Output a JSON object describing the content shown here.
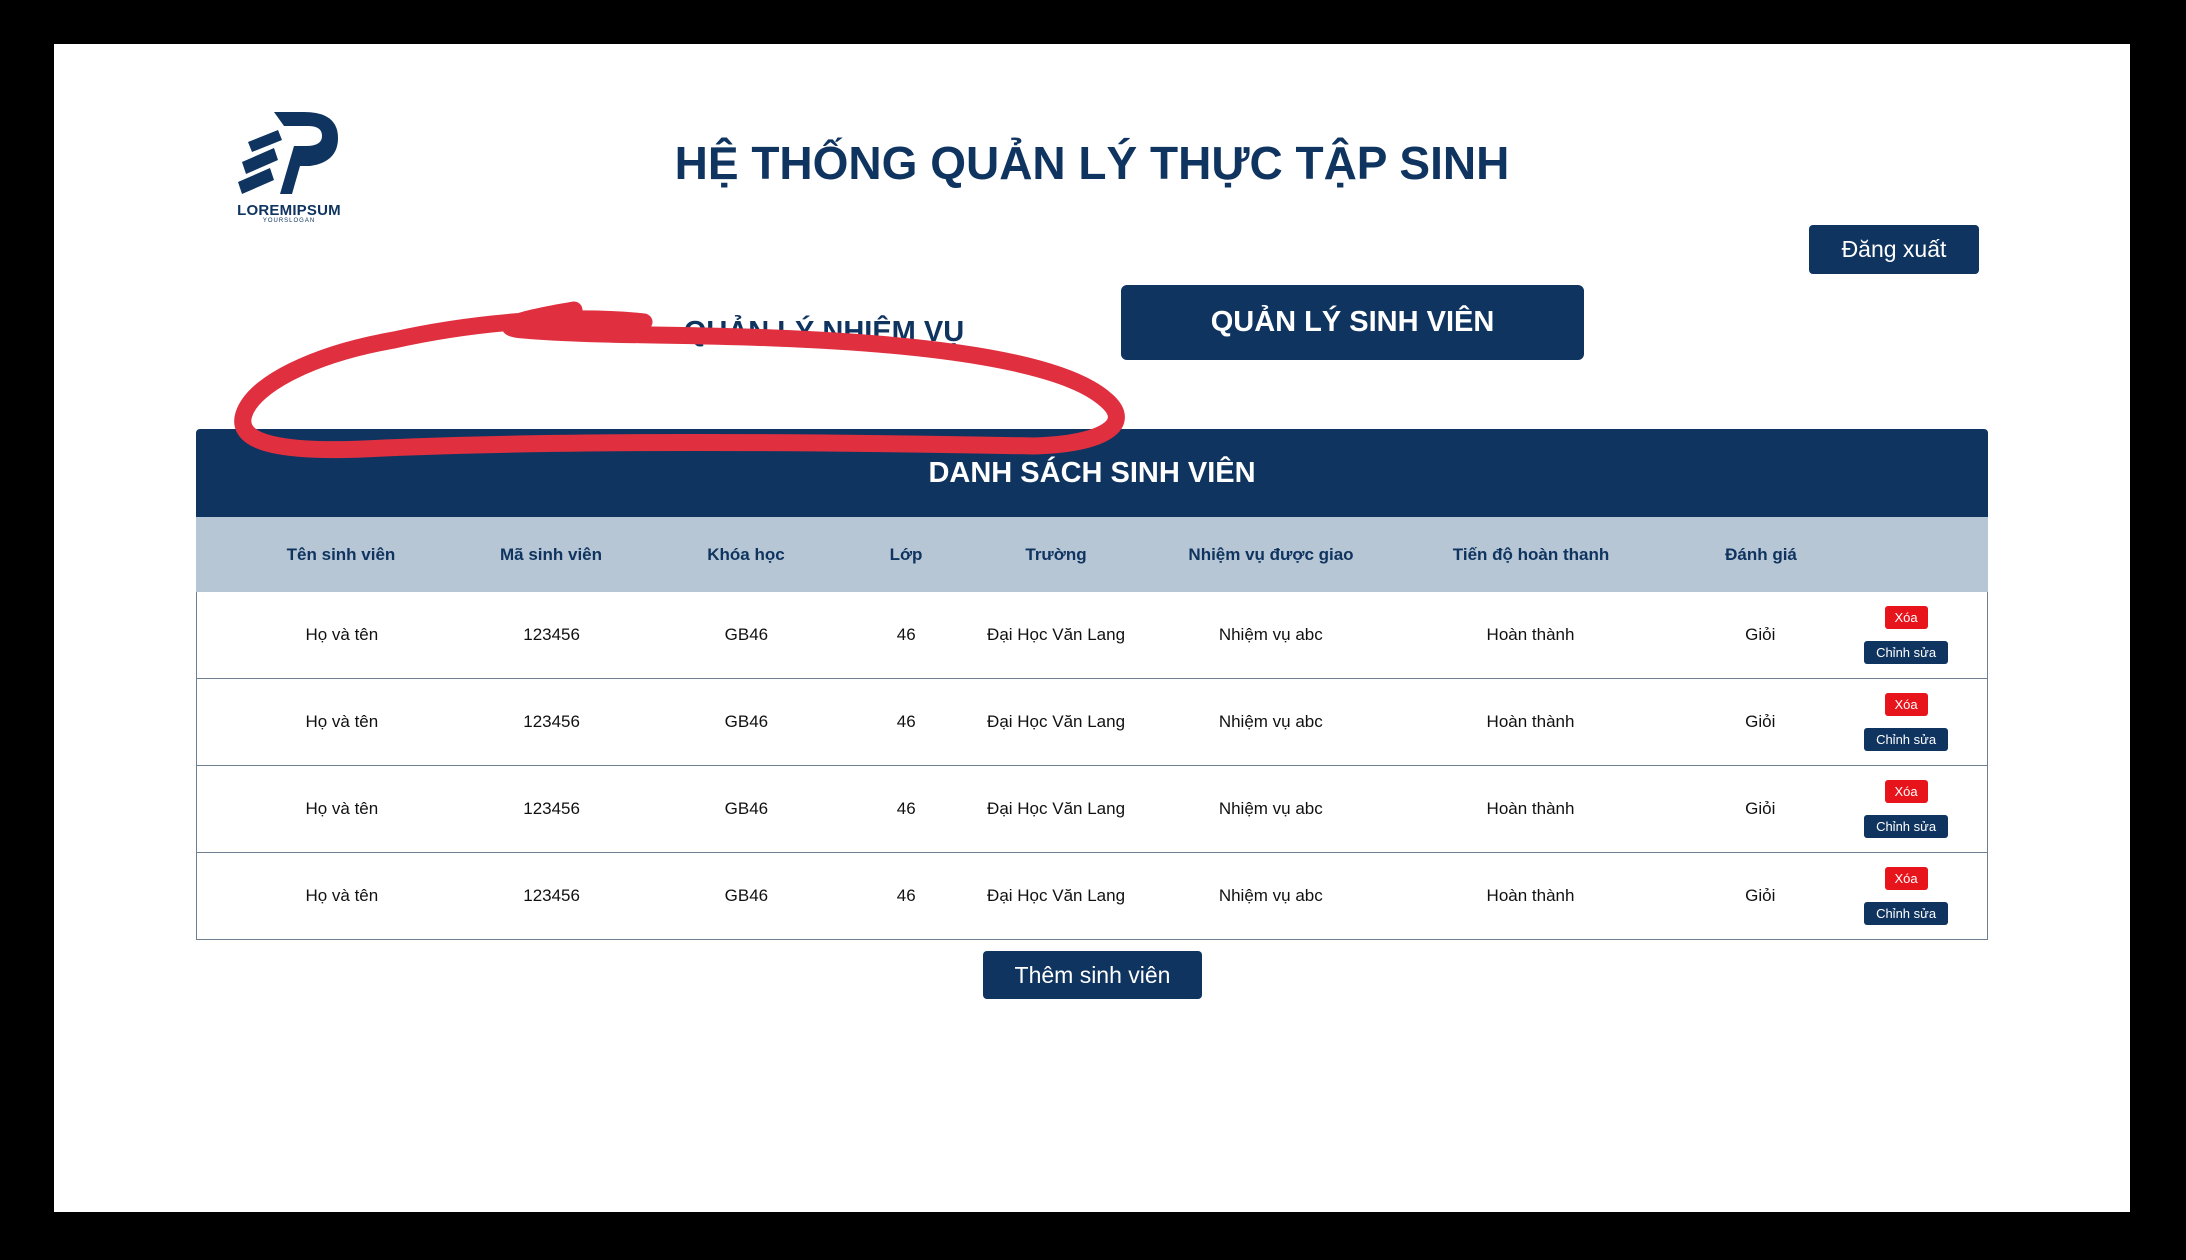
{
  "logo": {
    "name": "LOREMIPSUM",
    "slogan": "YOURSLOGAN"
  },
  "header": {
    "title": "HỆ THỐNG QUẢN LÝ THỰC TẬP SINH",
    "logout_label": "Đăng xuất"
  },
  "tabs": [
    {
      "label": "QUẢN LÝ NHIỆM  VỤ",
      "active": false
    },
    {
      "label": "QUẢN LÝ SINH VIÊN",
      "active": true
    }
  ],
  "table": {
    "title": "DANH SÁCH SINH VIÊN",
    "columns": [
      "Tên sinh viên",
      "Mã sinh viên",
      "Khóa học",
      "Lớp",
      "Trường",
      "Nhiệm vụ được giao",
      "Tiến độ hoàn thanh",
      "Đánh giá"
    ],
    "rows": [
      {
        "name": "Họ và tên",
        "student_id": "123456",
        "course": "GB46",
        "class": "46",
        "school": "Đại Học Văn Lang",
        "task": "Nhiệm vụ abc",
        "progress": "Hoàn thành",
        "rating": "Giỏi",
        "delete_label": "Xóa",
        "edit_label": "Chỉnh sửa"
      },
      {
        "name": "Họ và tên",
        "student_id": "123456",
        "course": "GB46",
        "class": "46",
        "school": "Đại Học Văn Lang",
        "task": "Nhiệm vụ abc",
        "progress": "Hoàn thành",
        "rating": "Giỏi",
        "delete_label": "Xóa",
        "edit_label": "Chỉnh sửa"
      },
      {
        "name": "Họ và tên",
        "student_id": "123456",
        "course": "GB46",
        "class": "46",
        "school": "Đại Học Văn Lang",
        "task": "Nhiệm vụ abc",
        "progress": "Hoàn thành",
        "rating": "Giỏi",
        "delete_label": "Xóa",
        "edit_label": "Chỉnh sửa"
      },
      {
        "name": "Họ và tên",
        "student_id": "123456",
        "course": "GB46",
        "class": "46",
        "school": "Đại Học Văn Lang",
        "task": "Nhiệm vụ abc",
        "progress": "Hoàn thành",
        "rating": "Giỏi",
        "delete_label": "Xóa",
        "edit_label": "Chỉnh sửa"
      }
    ]
  },
  "add_button_label": "Thêm sinh viên",
  "colors": {
    "primary": "#0f3460",
    "header_row": "#b7c6d4",
    "danger": "#e8141c",
    "annotation": "#e03040"
  }
}
